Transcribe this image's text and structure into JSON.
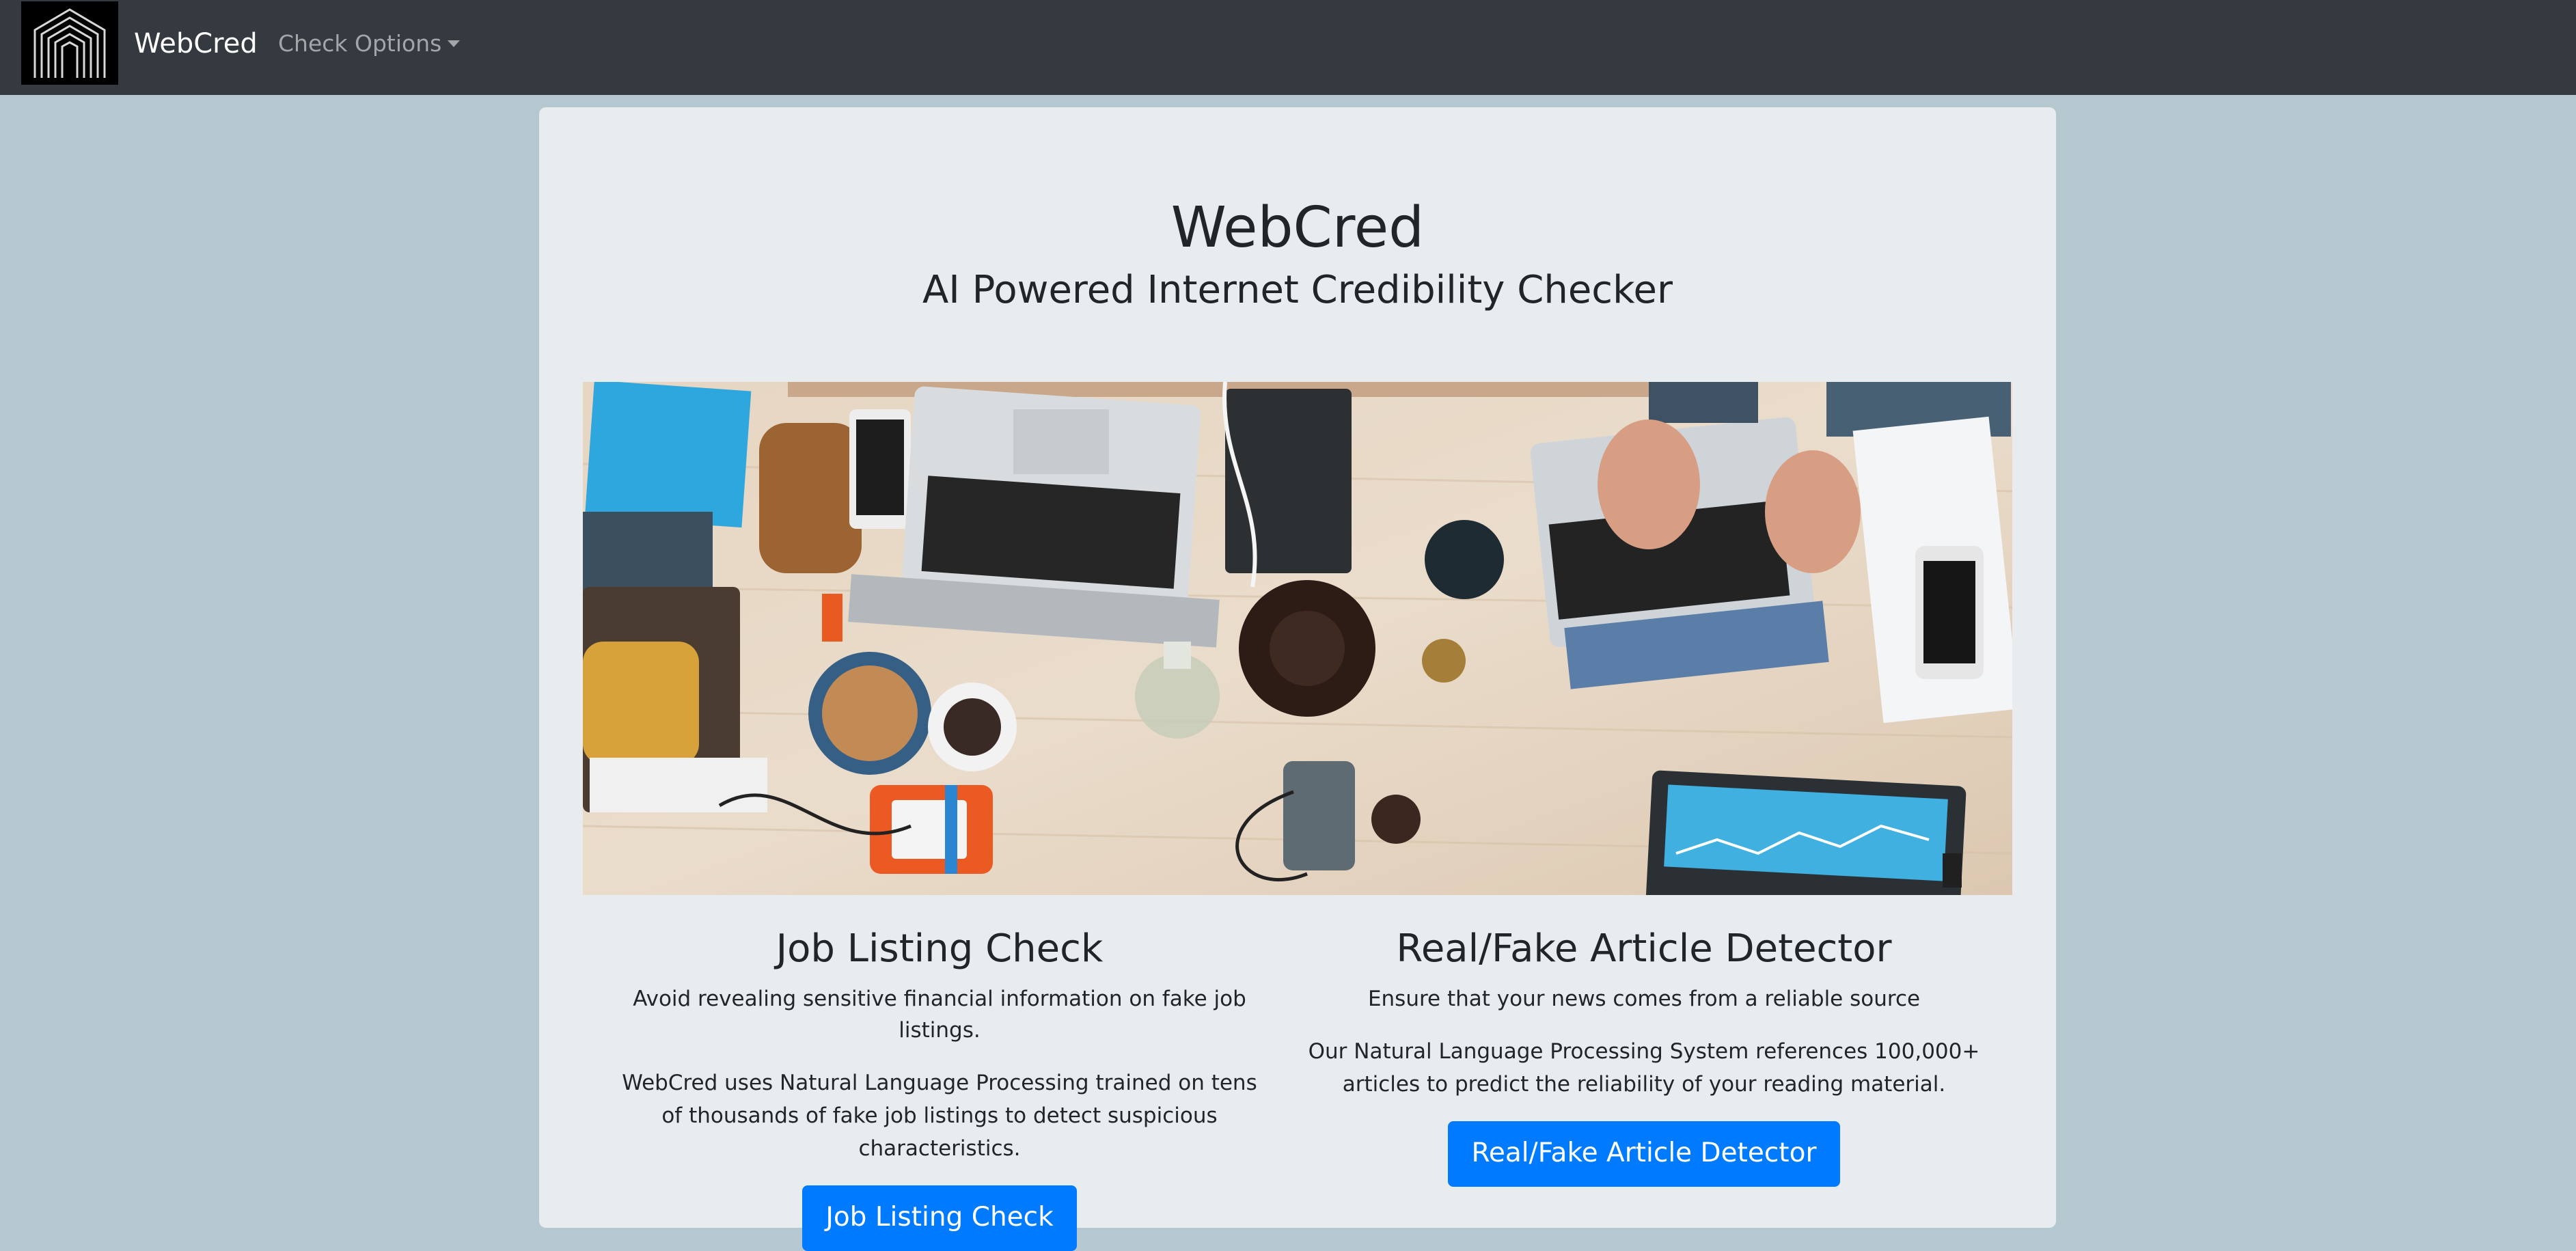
{
  "navbar": {
    "brand": "WebCred",
    "dropdown_label": "Check Options",
    "logo_icon": "archway-logo-icon"
  },
  "hero": {
    "title": "WebCred",
    "subtitle": "AI Powered Internet Credibility Checker",
    "image": "desk-workspace-photo"
  },
  "features": [
    {
      "heading": "Job Listing Check",
      "lead": "Avoid revealing sensitive financial information on fake job listings.",
      "description": "WebCred uses Natural Language Processing trained on tens of thousands of fake job listings to detect suspicious characteristics.",
      "button_label": "Job Listing Check"
    },
    {
      "heading": "Real/Fake Article Detector",
      "lead": "Ensure that your news comes from a reliable source",
      "description": "Our Natural Language Processing System references 100,000+ articles to predict the reliability of your reading material.",
      "button_label": "Real/Fake Article Detector"
    }
  ],
  "colors": {
    "page_background": "#b6c8cf",
    "navbar": "#343a40",
    "card": "#e8ecef",
    "primary_button": "#007bff"
  }
}
